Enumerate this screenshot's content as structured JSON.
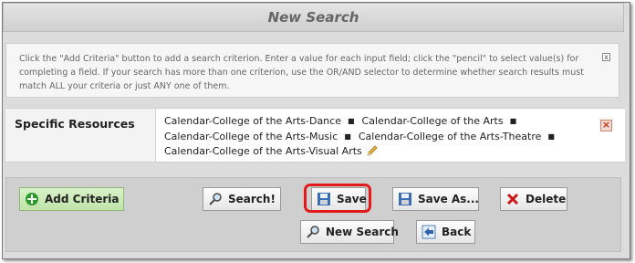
{
  "dialog": {
    "title": "New Search"
  },
  "help": {
    "text": "Click the \"Add Criteria\" button to add a search criterion. Enter a value for each input field; click the \"pencil\" to select value(s) for completing a field. If your search has more than one criterion, use the OR/AND selector to determine whether search results must match ALL your criteria or just ANY one of them.",
    "close_symbol": "x"
  },
  "criterion": {
    "label": "Specific Resources",
    "values": [
      "Calendar-College of the Arts-Dance",
      "Calendar-College of the Arts",
      "Calendar-College of the Arts-Music",
      "Calendar-College of the Arts-Theatre",
      "Calendar-College of the Arts-Visual Arts"
    ],
    "separator": "■",
    "edit_icon": "pencil-icon",
    "remove_symbol": "×"
  },
  "buttons": {
    "add_criteria": "Add Criteria",
    "search": "Search!",
    "save": "Save",
    "save_as": "Save As...",
    "delete": "Delete",
    "new_search": "New Search",
    "back": "Back"
  },
  "colors": {
    "highlight": "#e21a1a",
    "add_button_bg": "#c8eab3",
    "remove_icon": "#c23b15"
  }
}
